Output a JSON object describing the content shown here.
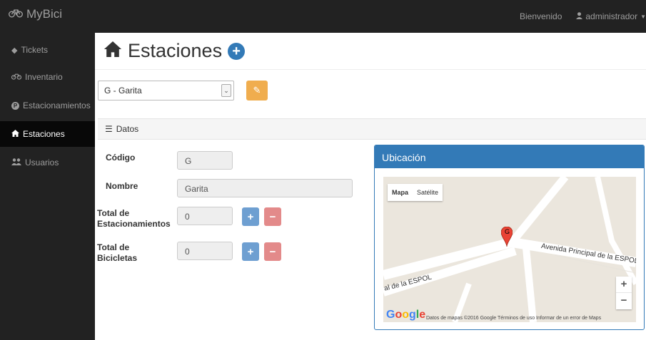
{
  "navbar": {
    "brand": "MyBici",
    "welcome": "Bienvenido",
    "user": "administrador"
  },
  "sidebar": {
    "items": [
      {
        "label": "Tickets",
        "icon": "ticket-icon"
      },
      {
        "label": "Inventario",
        "icon": "bicycle-icon"
      },
      {
        "label": "Estacionamientos",
        "icon": "parking-icon"
      },
      {
        "label": "Estaciones",
        "icon": "home-icon",
        "active": true
      },
      {
        "label": "Usuarios",
        "icon": "users-icon"
      }
    ]
  },
  "page": {
    "title": "Estaciones"
  },
  "station_select": {
    "value": "G - Garita"
  },
  "section": {
    "title": "Datos"
  },
  "form": {
    "codigo_label": "Código",
    "codigo_value": "G",
    "nombre_label": "Nombre",
    "nombre_value": "Garita",
    "estacionamientos_label_1": "Total de",
    "estacionamientos_label_2": "Estacionamientos",
    "estacionamientos_value": "0",
    "bicicletas_label_1": "Total de",
    "bicicletas_label_2": "Bicicletas",
    "bicicletas_value": "0",
    "plus": "+",
    "minus": "−"
  },
  "map": {
    "title": "Ubicación",
    "type_map": "Mapa",
    "type_sat": "Satélite",
    "road_label_1": "Avenida Principal de la ESPOL",
    "road_label_2": "al de la ESPOL",
    "marker": "G",
    "zoom_in": "+",
    "zoom_out": "−",
    "google": "Google",
    "attribution": "Datos de mapas ©2016 Google   Términos de uso   Informar de un error de Maps"
  },
  "colors": {
    "navbar_bg": "#222222",
    "primary": "#337ab7",
    "warning": "#f0ad4e",
    "danger": "#e38a8a"
  }
}
